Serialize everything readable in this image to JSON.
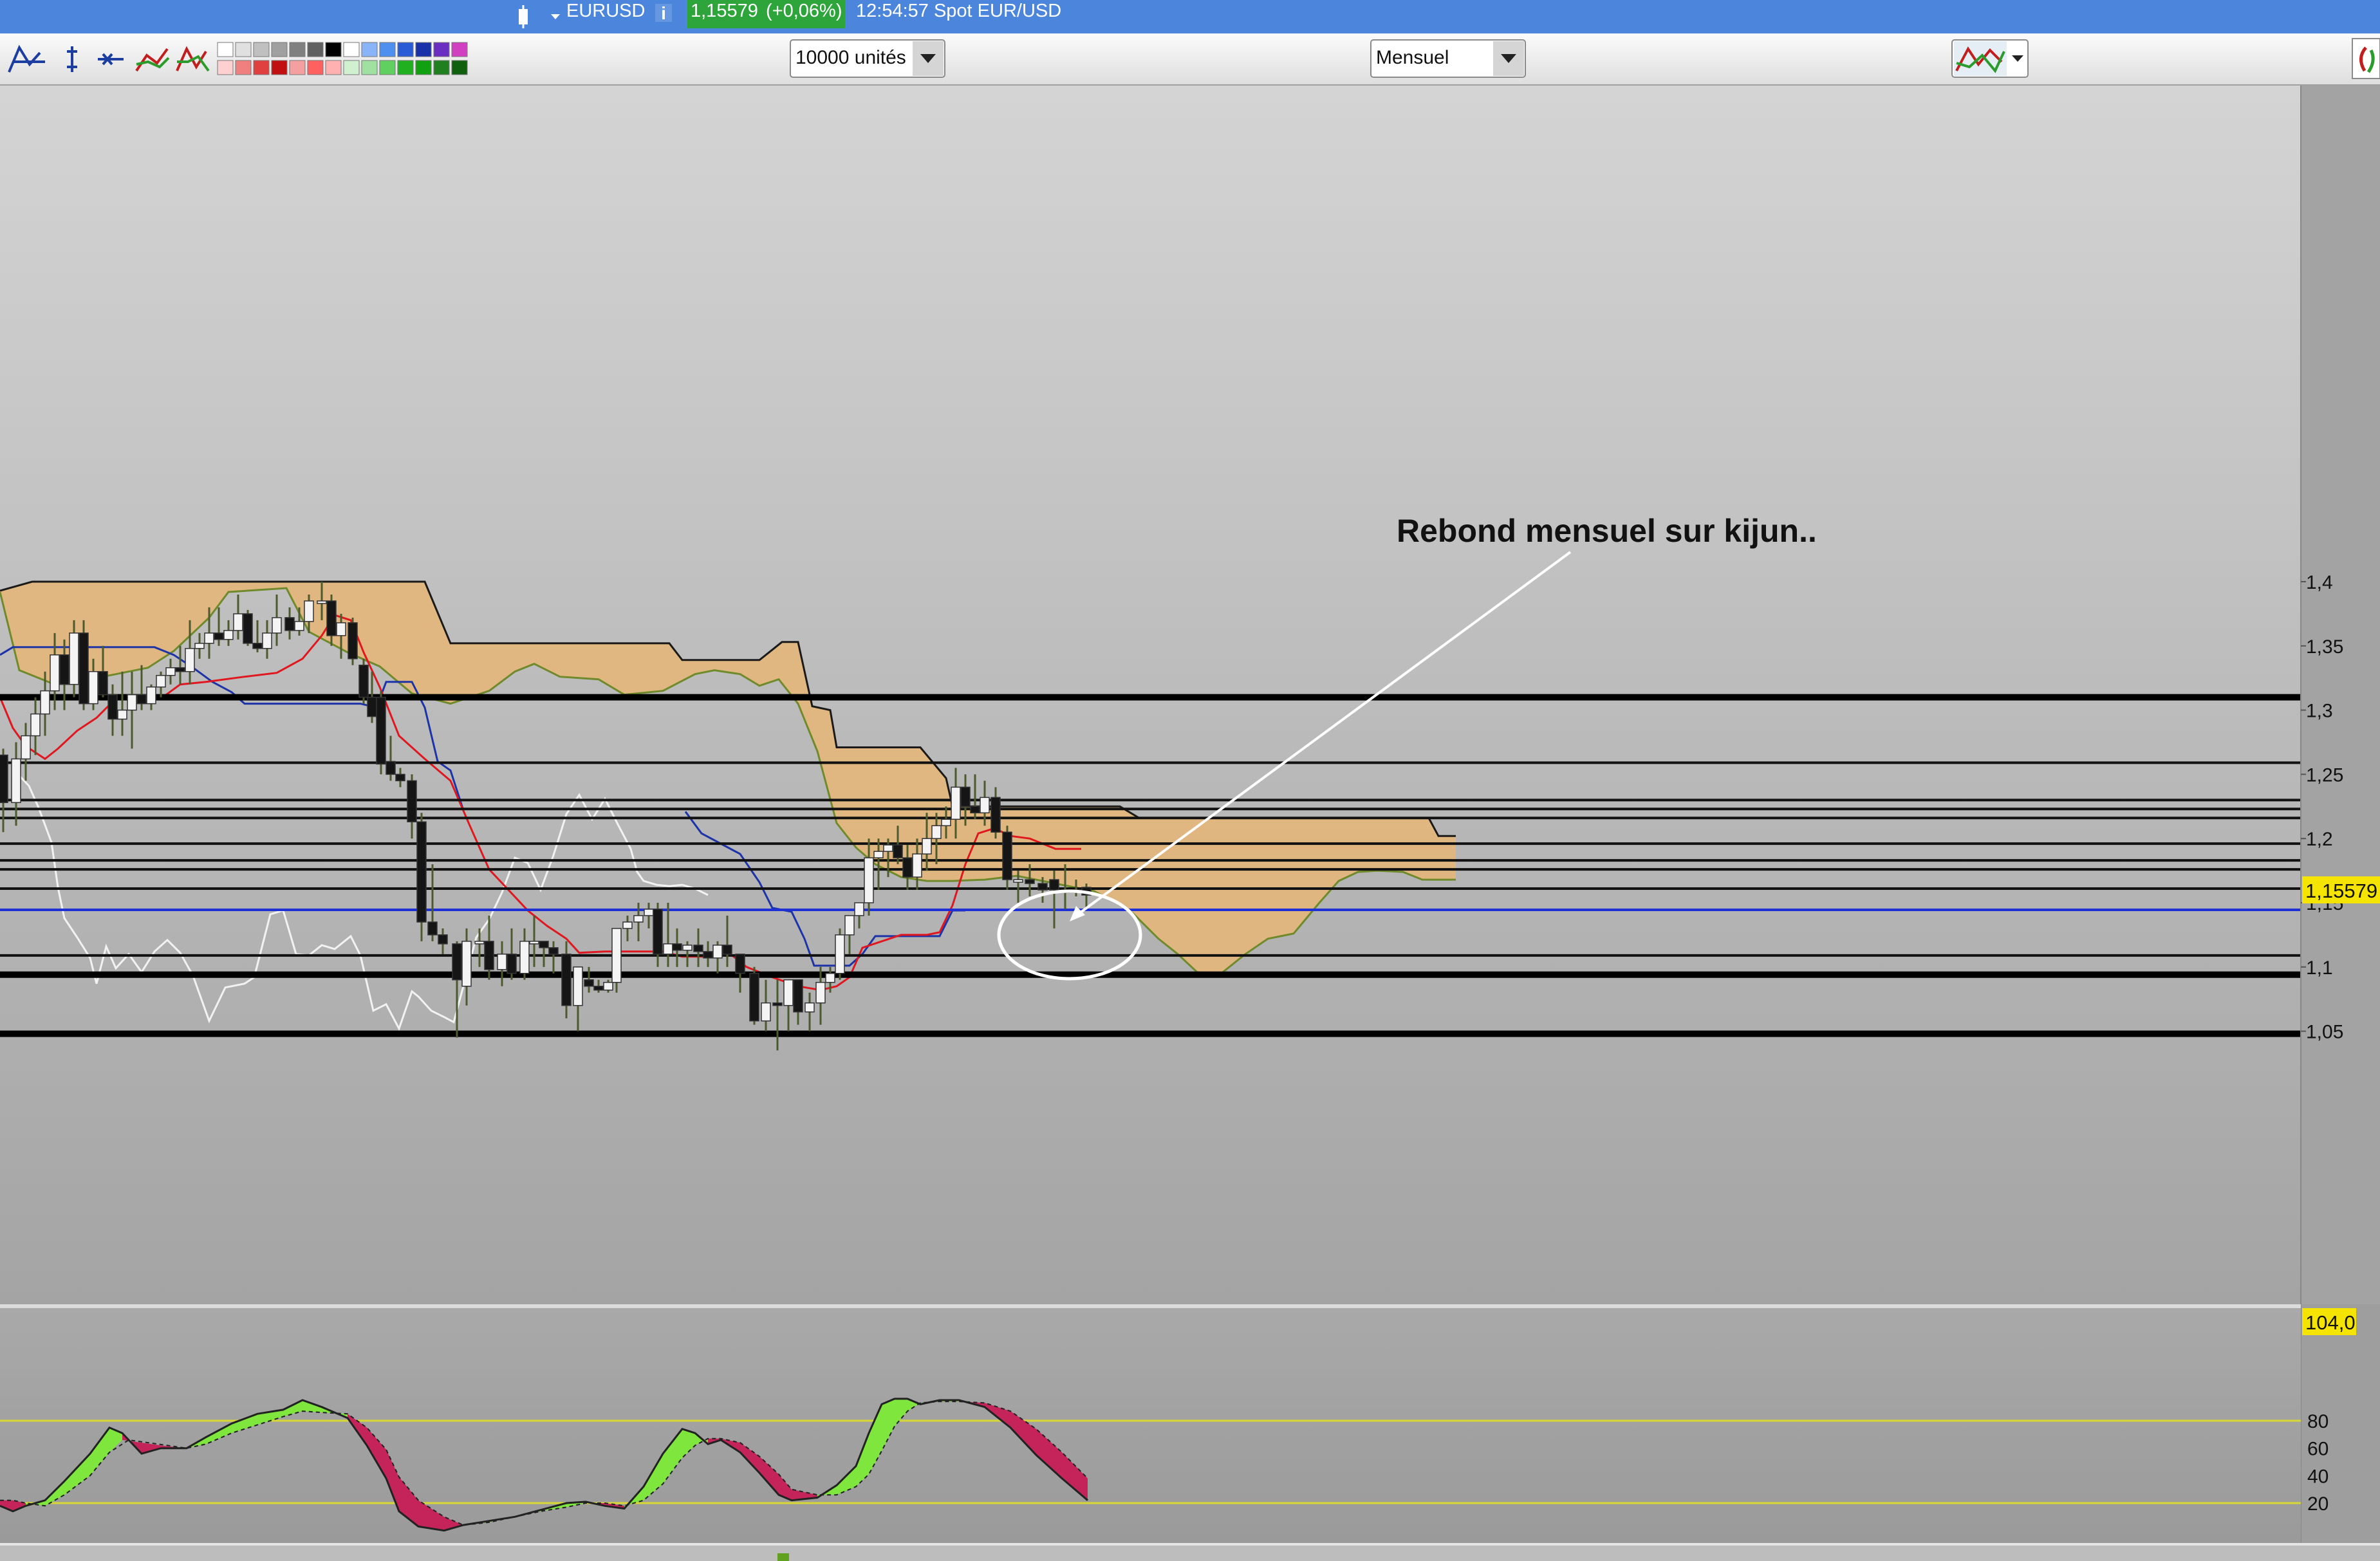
{
  "titlebar": {
    "instrument": "EURUSD",
    "info_icon": "info-icon",
    "price": "1,15579",
    "change": "(+0,06%)",
    "clock": "12:54:57 Spot EUR/USD"
  },
  "toolbar": {
    "quantity_select": "10000 unités",
    "period_select": "Mensuel",
    "icons": [
      "trend-lines-icon",
      "cursor-icon",
      "crosshair-icon",
      "indicator-icon",
      "chart-type-icon",
      "color-palette-icon",
      "indicators-menu-icon",
      "refresh-icon"
    ]
  },
  "chart": {
    "type": "candlestick-ichimoku",
    "annotation": "Rebond mensuel sur kijun..",
    "price_axis": {
      "labels": [
        "1,4",
        "1,35",
        "1,3",
        "1,25",
        "1,2",
        "1,15",
        "1,1",
        "1,05"
      ],
      "values": [
        1.4,
        1.35,
        1.3,
        1.25,
        1.2,
        1.15,
        1.1,
        1.05
      ],
      "range": [
        1.02,
        1.42
      ]
    },
    "current_price_tag": "1,15579",
    "horizontal_levels": [
      1.31,
      1.259,
      1.23,
      1.223,
      1.216,
      1.196,
      1.183,
      1.176,
      1.161,
      1.109
    ],
    "thick_levels": [
      1.31,
      1.094,
      1.048
    ],
    "blue_level": 1.1445,
    "colors": {
      "background": "#b2b2b2",
      "cloud": "#e3b67d",
      "tenkan": "#e0171f",
      "kijun": "#1d33a8",
      "chikou": "#f2f2f2",
      "senkou_b": "#1a1a1a",
      "senkou_a": "#6f8a2a"
    }
  },
  "oscillator": {
    "top_tag": "104,0",
    "labels": [
      "80",
      "60",
      "40",
      "20"
    ],
    "values": [
      80,
      60,
      40,
      20
    ],
    "range": [
      0,
      104
    ],
    "bands": [
      80,
      20
    ],
    "colors": {
      "up": "#7ee63c",
      "down": "#c4245a",
      "band": "#d8d835"
    }
  }
}
